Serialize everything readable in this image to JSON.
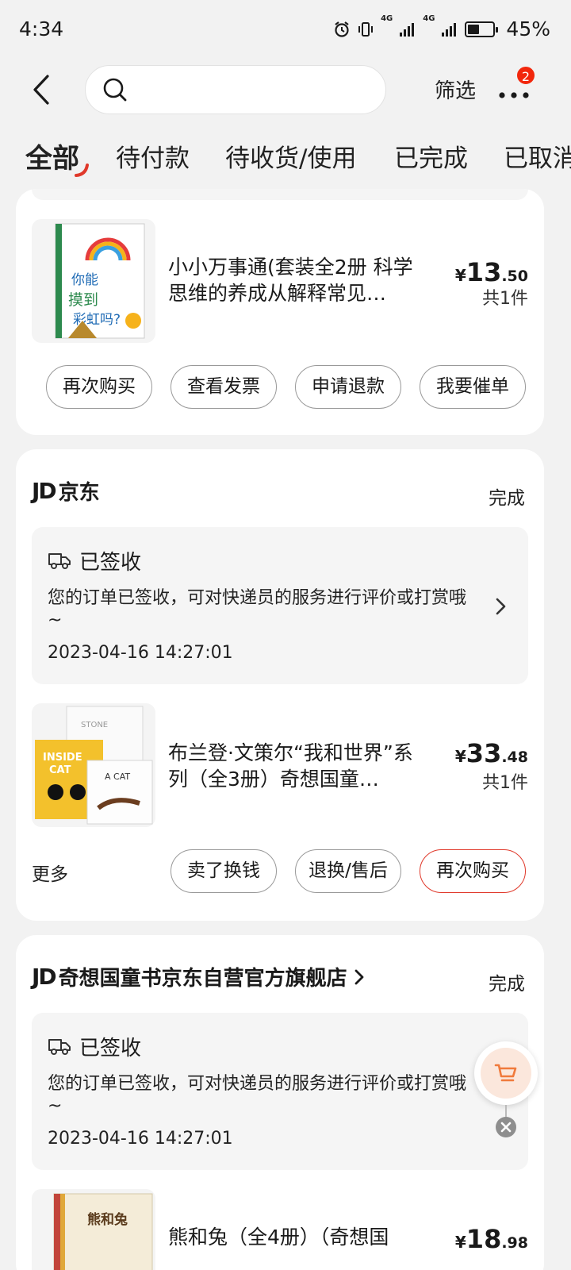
{
  "status_bar": {
    "time": "4:34",
    "network1": "4G",
    "network2": "4G",
    "battery_percent": "45%",
    "battery_level": 0.45
  },
  "header": {
    "search_placeholder": "",
    "filter_label": "筛选",
    "badge_count": "2"
  },
  "tabs": [
    {
      "label": "全部",
      "active": true
    },
    {
      "label": "待付款"
    },
    {
      "label": "待收货/使用"
    },
    {
      "label": "已完成"
    },
    {
      "label": "已取消"
    }
  ],
  "orders": [
    {
      "title": "小小万事通(套装全2册 科学思维的养成从解释常见…",
      "price_currency": "¥",
      "price_int": "13",
      "price_dec": ".50",
      "qty": "共1件",
      "actions": [
        "再次购买",
        "查看发票",
        "申请退款",
        "我要催单"
      ]
    },
    {
      "shop_logo": "JD",
      "shop_name": "京东",
      "status": "完成",
      "delivery_title": "已签收",
      "delivery_desc": "您的订单已签收，可对快递员的服务进行评价或打赏哦~",
      "delivery_time": "2023-04-16 14:27:01",
      "title": "布兰登·文策尔“我和世界”系列（全3册）奇想国童…",
      "price_currency": "¥",
      "price_int": "33",
      "price_dec": ".48",
      "qty": "共1件",
      "more_label": "更多",
      "actions": [
        "卖了换钱",
        "退换/售后",
        "再次购买"
      ]
    },
    {
      "shop_logo": "JD",
      "shop_name": "奇想国童书京东自营官方旗舰店",
      "status": "完成",
      "delivery_title": "已签收",
      "delivery_desc": "您的订单已签收，可对快递员的服务进行评价或打赏哦~",
      "delivery_time": "2023-04-16 14:27:01",
      "title": "熊和兔（全4册）（奇想国",
      "price_currency": "¥",
      "price_int": "18",
      "price_dec": ".98"
    }
  ],
  "colors": {
    "accent": "#e0392b",
    "badge": "#f2270c",
    "background": "#f2f2f2"
  }
}
